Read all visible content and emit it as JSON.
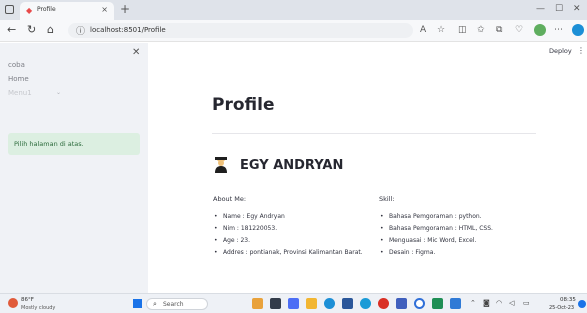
{
  "browser": {
    "tab_title": "Profile",
    "url": "localhost:8501/Profile",
    "new_tab_glyph": "+"
  },
  "sidebar": {
    "nav_items": [
      "coba",
      "Home",
      "Menu1"
    ],
    "info_text": "Pilih halaman di atas."
  },
  "header": {
    "deploy_label": "Deploy"
  },
  "main": {
    "title": "Profile",
    "name": "EGY ANDRYAN",
    "about_heading": "About Me:",
    "skill_heading": "Skill:",
    "about_items": [
      "Name : Egy Andryan",
      "Nim : 181220053.",
      "Age : 23.",
      "Addres : pontianak, Provinsi Kalimantan Barat."
    ],
    "skill_items": [
      "Bahasa Pemgoraman : python.",
      "Bahasa Pemgoraman : HTML, CSS.",
      "Menguasai : Mic Word, Excel.",
      "Desain : Figma."
    ]
  },
  "taskbar": {
    "weather_temp": "86°F",
    "weather_desc": "Mostly cloudy",
    "search_label": "Search",
    "time": "08:35",
    "date": "25-Oct-23"
  },
  "colors": {
    "sidebar_bg": "#f0f2f6",
    "info_bg": "#dcefe1",
    "info_text": "#2c6b3c",
    "title_text": "#262730"
  }
}
